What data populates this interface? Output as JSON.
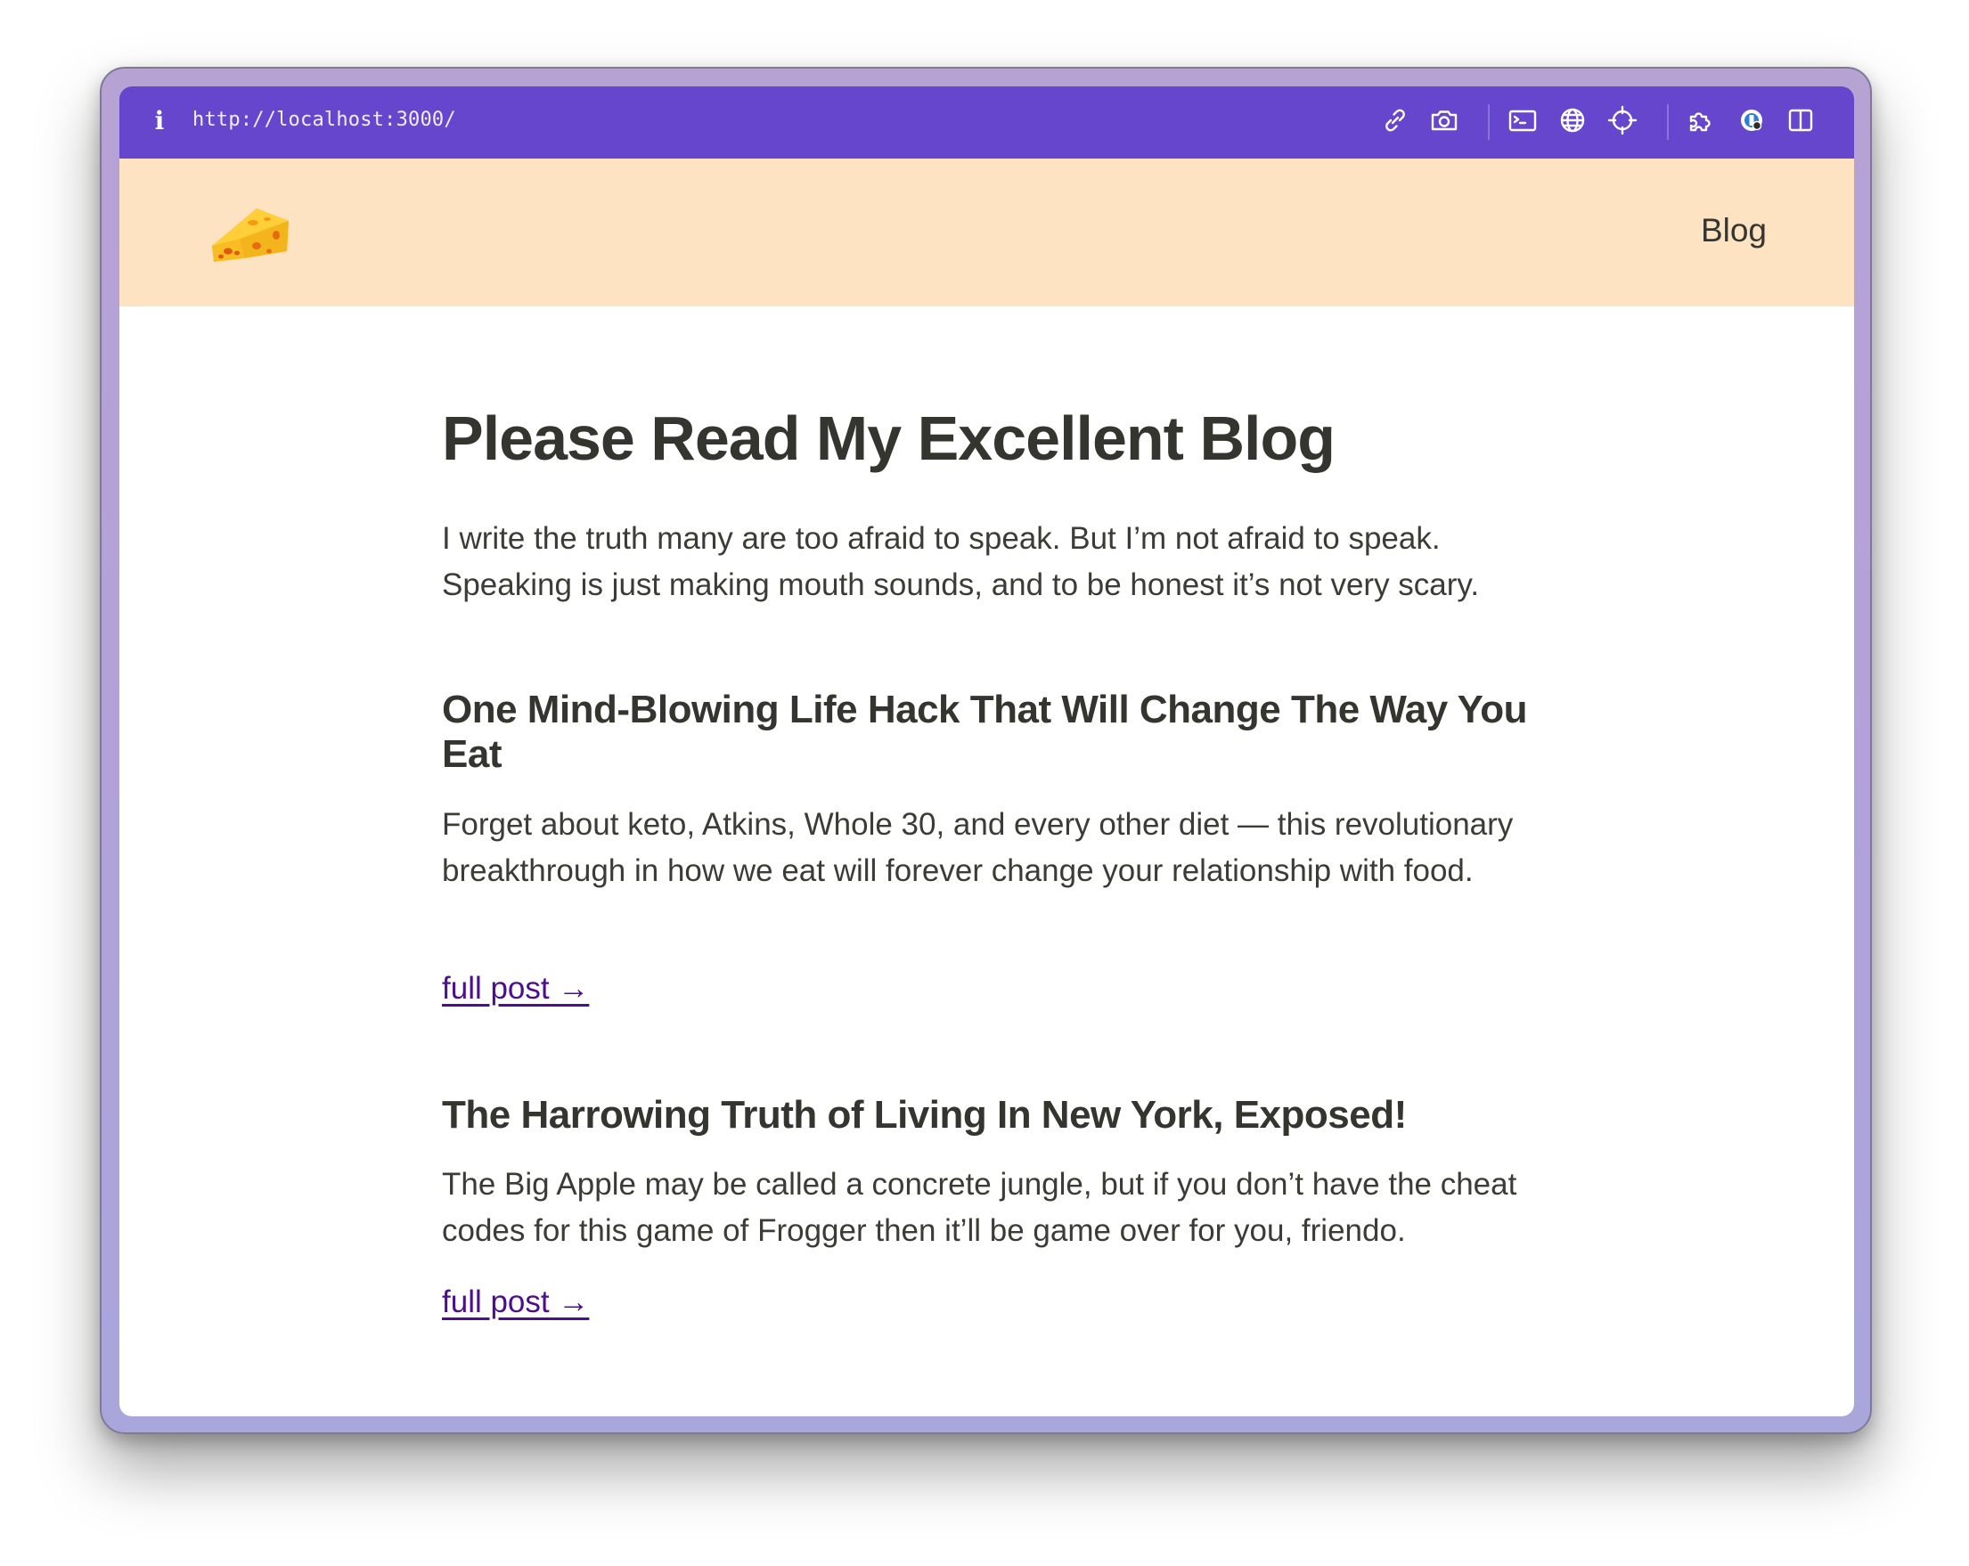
{
  "browser": {
    "url": "http://localhost:3000/",
    "info_glyph": "i",
    "icons": [
      "link-icon",
      "camera-icon",
      "terminal-icon",
      "globe-icon",
      "crosshair-icon",
      "extensions-icon",
      "profile-icon",
      "sidebar-icon"
    ],
    "bar_color": "#6546cd"
  },
  "site": {
    "header_color": "#fee3c3",
    "logo": "cheese-logo",
    "nav": {
      "blog_label": "Blog"
    }
  },
  "main": {
    "title": "Please Read My Excellent Blog",
    "intro": "I write the truth many are too afraid to speak. But I’m not afraid to speak. Speaking is just making mouth sounds, and to be honest it’s not very scary.",
    "posts": [
      {
        "title": "One Mind-Blowing Life Hack That Will Change The Way You Eat",
        "excerpt": "Forget about keto, Atkins, Whole 30, and every other diet — this revolutionary breakthrough in how we eat will forever change your relationship with food.",
        "link_label": "full post →"
      },
      {
        "title": "The Harrowing Truth of Living In New York, Exposed!",
        "excerpt": "The Big Apple may be called a concrete jungle, but if you don’t have the cheat codes for this game of Frogger then it’ll be game over for you, friendo.",
        "link_label": "full post →"
      }
    ],
    "link_color": "#4b0f8c"
  }
}
